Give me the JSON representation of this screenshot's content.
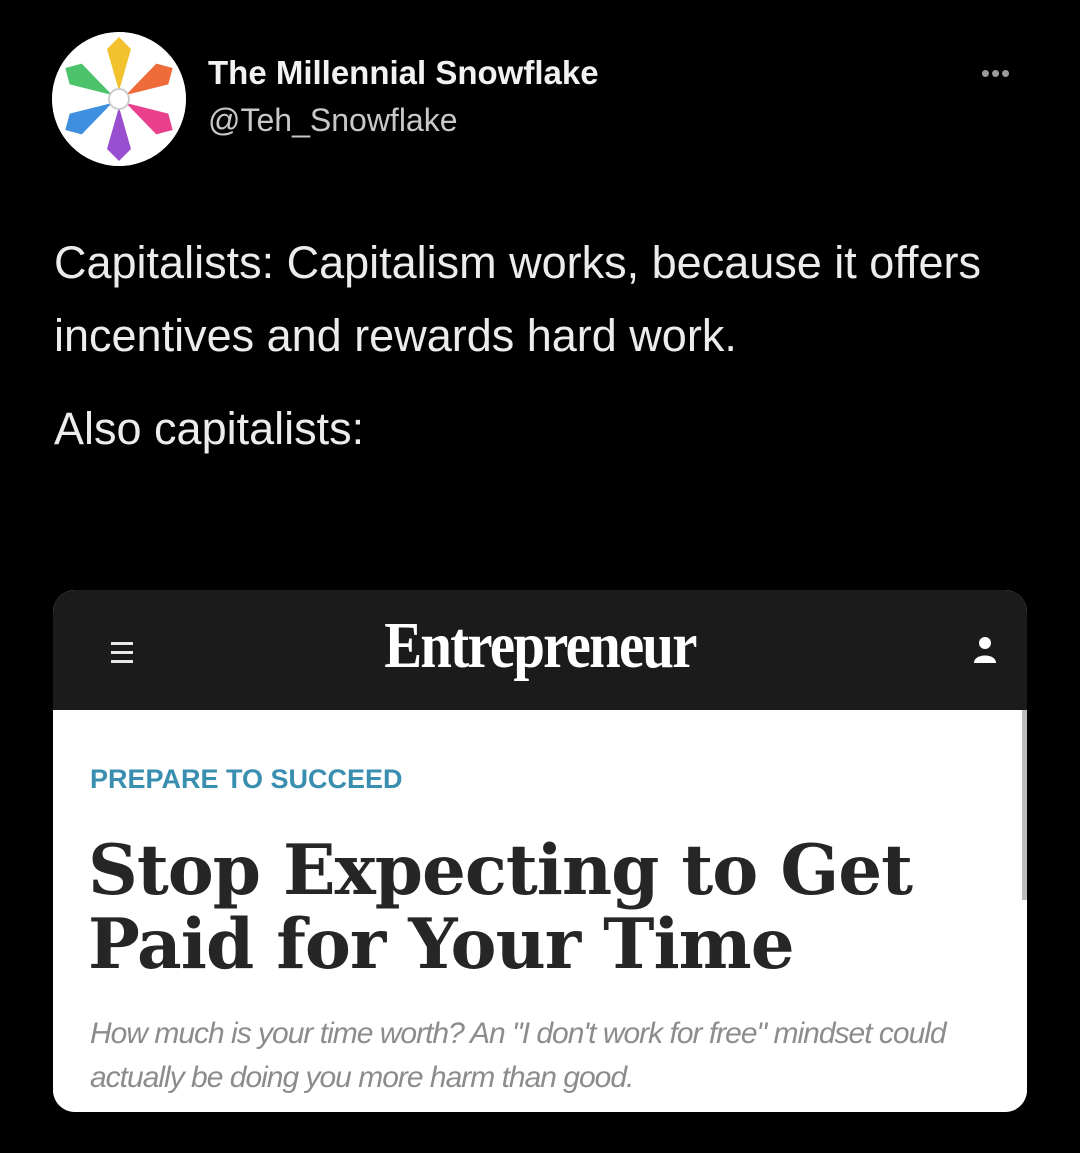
{
  "tweet": {
    "display_name": "The Millennial Snowflake",
    "handle": "@Teh_Snowflake",
    "more_icon": "more-horizontal-icon",
    "paragraphs": [
      "Capitalists: Capitalism works, because it offers incentives and rewards hard work.",
      "Also capitalists:"
    ]
  },
  "card": {
    "brand": "Entrepreneur",
    "menu_icon": "hamburger-menu-icon",
    "user_icon": "user-icon",
    "kicker": "PREPARE TO SUCCEED",
    "headline": "Stop Expecting to Get Paid for Your Time",
    "dek": "How much is your time worth? An \"I don't work for free\" mindset could actually be doing you more harm than good.",
    "colors": {
      "bar": "#1b1b1b",
      "kicker": "#3a8fb0",
      "headline": "#262626",
      "dek": "#8c8c8c"
    }
  }
}
